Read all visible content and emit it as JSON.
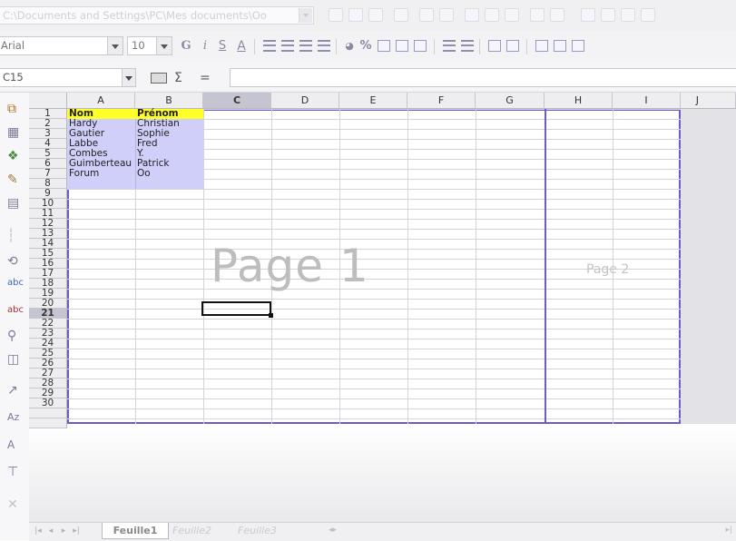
{
  "url_bar": {
    "path": "C:\\Documents and Settings\\PC\\Mes documents\\Oo"
  },
  "format_bar": {
    "font_name": "Arial",
    "font_size": "10",
    "bold": "G",
    "italic": "i",
    "underline": "S",
    "font_color": "A",
    "percent": "%"
  },
  "formula_bar": {
    "name_box": "C15",
    "sum": "Σ",
    "equals": "=",
    "formula": ""
  },
  "columns": [
    "A",
    "B",
    "C",
    "D",
    "E",
    "F",
    "G",
    "H",
    "I",
    "J"
  ],
  "active_column": "C",
  "rows": [
    "1",
    "2",
    "3",
    "4",
    "5",
    "6",
    "7",
    "8",
    "9",
    "10",
    "11",
    "12",
    "13",
    "14",
    "15",
    "16",
    "17",
    "18",
    "19",
    "20",
    "21",
    "22",
    "23",
    "24",
    "25",
    "26",
    "27",
    "28",
    "29",
    "30"
  ],
  "active_row": "15",
  "table": {
    "header": [
      "Nom",
      "Prénom"
    ],
    "rows": [
      [
        "Hardy",
        "Christian"
      ],
      [
        "Gautier",
        "Sophie"
      ],
      [
        "Labbe",
        "Fred"
      ],
      [
        "Combes",
        "Y."
      ],
      [
        "Guimberteau",
        "Patrick"
      ],
      [
        "Forum",
        "Oo"
      ]
    ]
  },
  "page_labels": {
    "page1": "Page 1",
    "page2": "Page 2"
  },
  "sheet_tabs": {
    "active": "Feuille1",
    "others": [
      "Feuille2",
      "Feuille3"
    ]
  },
  "colors": {
    "page_border": "#6c5bc9",
    "data_fill": "#cfcffa",
    "header_fill": "#ffff2a"
  }
}
